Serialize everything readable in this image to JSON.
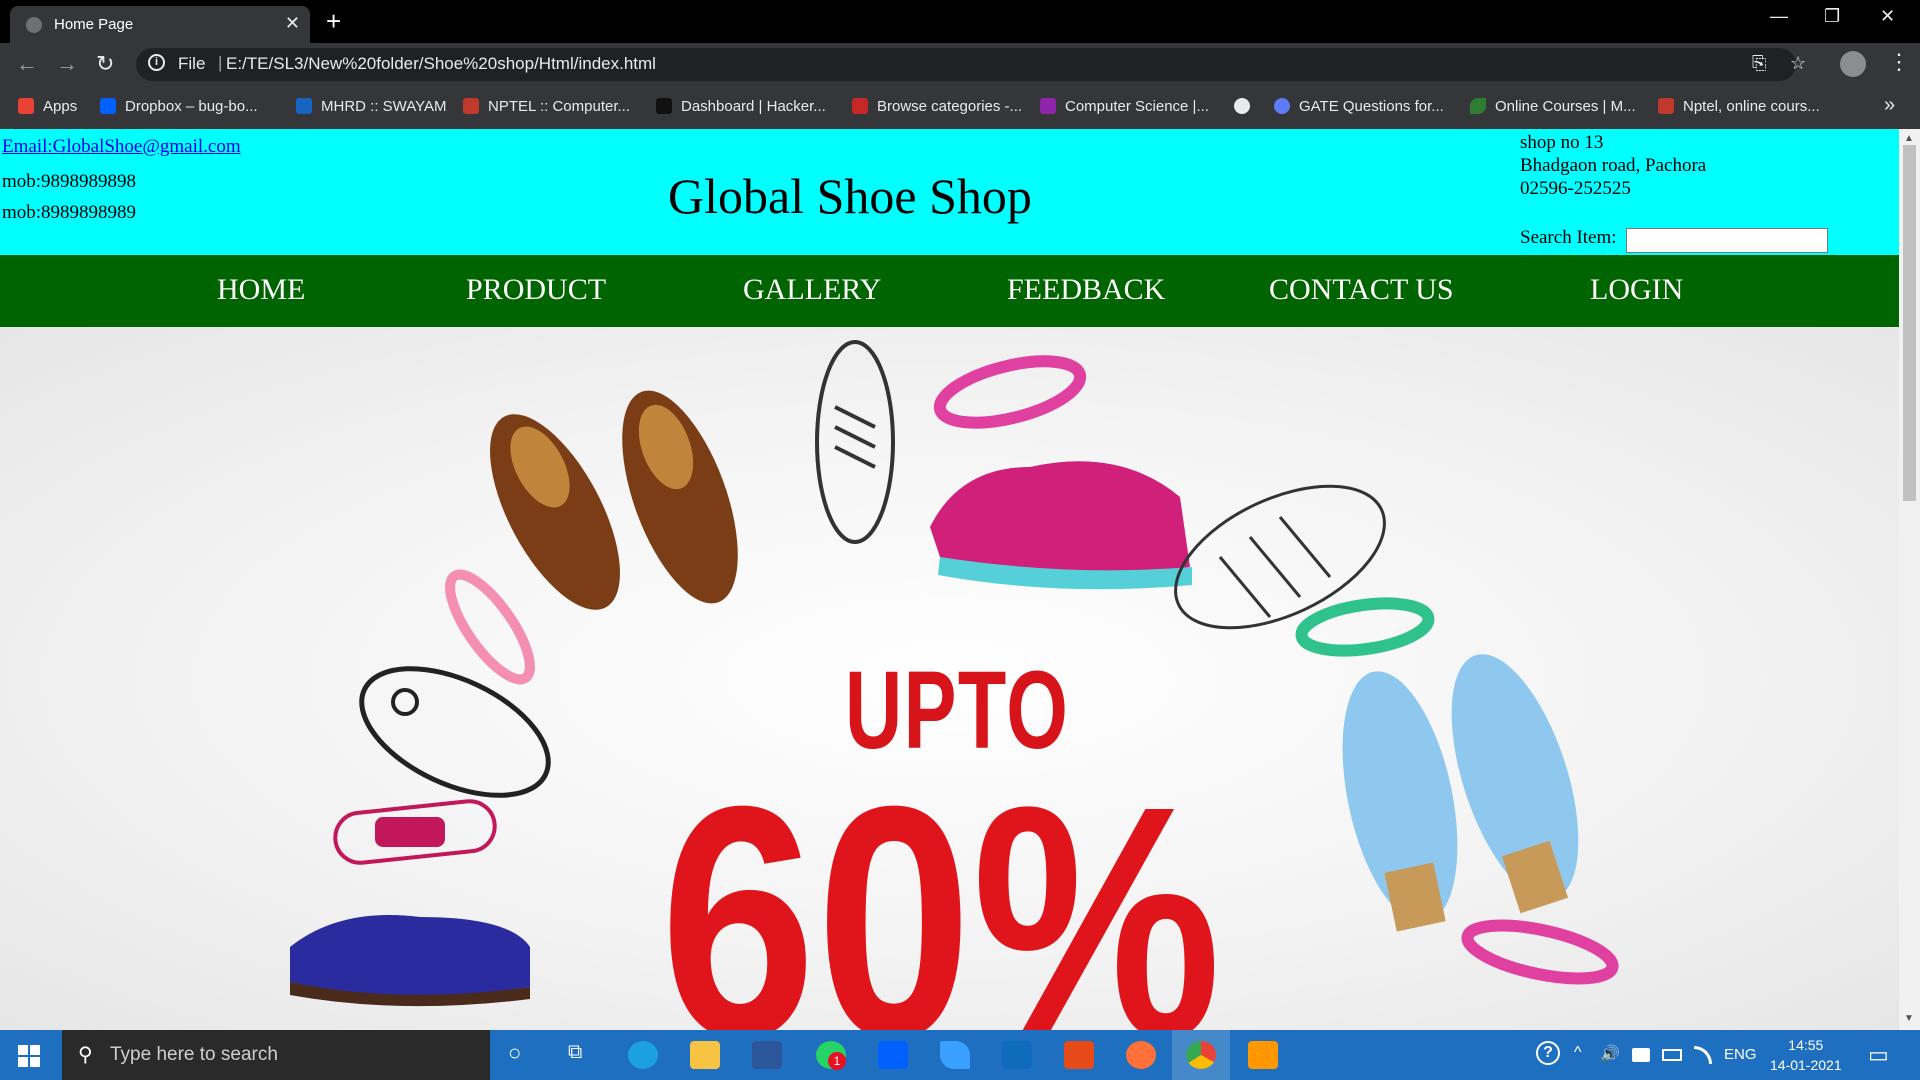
{
  "browser": {
    "tab_title": "Home Page",
    "tab_close": "✕",
    "new_tab": "+",
    "window_controls": {
      "minimize": "—",
      "restore": "❐",
      "close": "✕"
    },
    "nav_icons": {
      "back": "←",
      "forward": "→",
      "reload": "↻"
    },
    "address_scheme": "File",
    "address_url": "E:/TE/SL3/New%20folder/Shoe%20shop/Html/index.html",
    "translate_icon": "⎘",
    "bookmark_star": "☆",
    "menu": "⋮",
    "bookmarks": [
      {
        "label": "Apps",
        "color": "#ea4335"
      },
      {
        "label": "Dropbox – bug-bo...",
        "color": "#0061ff"
      },
      {
        "label": "MHRD :: SWAYAM",
        "color": "#1565c0"
      },
      {
        "label": "NPTEL :: Computer...",
        "color": "#c0392b"
      },
      {
        "label": "Dashboard | Hacker...",
        "color": "#111111"
      },
      {
        "label": "Browse categories -...",
        "color": "#c62828"
      },
      {
        "label": "Computer Science |...",
        "color": "#8e24aa"
      },
      {
        "label": "",
        "color": "#e8eaed"
      },
      {
        "label": "GATE Questions for...",
        "color": "#5c7cfa"
      },
      {
        "label": "Online Courses | M...",
        "color": "#2e7d32"
      },
      {
        "label": "Nptel, online cours...",
        "color": "#c0392b"
      }
    ],
    "bookmarks_more": "»"
  },
  "page": {
    "email": "Email:GlobalShoe@gmail.com",
    "mob1": "mob:9898989898",
    "mob2": "mob:8989898989",
    "title": "Global Shoe Shop",
    "address_lines": [
      "shop no 13",
      "Bhadgaon road, Pachora",
      "02596-252525"
    ],
    "search_label": "Search Item:",
    "search_value": "",
    "nav": [
      "HOME",
      "PRODUCT",
      "GALLERY",
      "FEEDBACK",
      "CONTACT US",
      "LOGIN"
    ],
    "banner": {
      "upto": "UPTO",
      "percent": "60%"
    }
  },
  "taskbar": {
    "search_placeholder": "Type here to search",
    "search_icon": "⚲",
    "cortana_icon": "○",
    "taskview_icon": "⧉",
    "badge": "1",
    "tray_help": "?",
    "tray_chevron": "^",
    "tray_volume": "🔊",
    "language": "ENG",
    "time": "14:55",
    "date": "14-01-2021",
    "notification_icon": "▭",
    "apps": [
      {
        "name": "edge",
        "color": "#1ba1e2"
      },
      {
        "name": "file-explorer",
        "color": "#f6c342"
      },
      {
        "name": "store",
        "color": "#2b579a"
      },
      {
        "name": "whatsapp",
        "color": "#25d366"
      },
      {
        "name": "dropbox",
        "color": "#0061ff"
      },
      {
        "name": "vscode-like",
        "color": "#3aa0ff"
      },
      {
        "name": "mail",
        "color": "#0f6cbd"
      },
      {
        "name": "office",
        "color": "#e64a19"
      },
      {
        "name": "firefox",
        "color": "#ff7139"
      },
      {
        "name": "chrome",
        "color": "#fbbc05"
      },
      {
        "name": "sublime",
        "color": "#ff9800"
      }
    ]
  }
}
